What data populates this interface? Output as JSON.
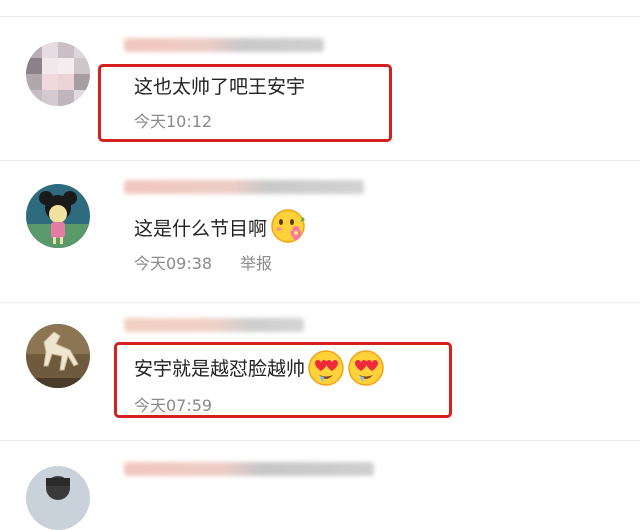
{
  "comments": [
    {
      "text": "这也太帅了吧王安宇",
      "time": "今天10:12",
      "highlighted": true,
      "avatar": "pixelated-avatar"
    },
    {
      "text": "这是什么节目啊",
      "time": "今天09:38",
      "report_label": "举报",
      "emojis": [
        "flower-blush-emoji"
      ],
      "avatar": "cartoon-girl-avatar"
    },
    {
      "text": "安宇就是越怼脸越帅",
      "time": "今天07:59",
      "highlighted": true,
      "emojis": [
        "heart-eyes-emoji",
        "heart-eyes-emoji"
      ],
      "avatar": "horse-statue-avatar"
    },
    {
      "avatar": "person-avatar"
    }
  ],
  "colors": {
    "highlight_border": "#d61f1f",
    "time_text": "#8a8a8a",
    "body_text": "#222222"
  }
}
